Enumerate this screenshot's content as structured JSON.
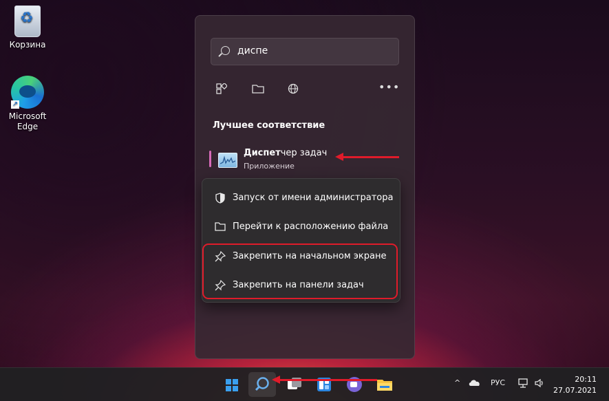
{
  "desktop": {
    "icons": [
      {
        "label": "Корзина"
      },
      {
        "label": "Microsoft Edge"
      }
    ]
  },
  "start": {
    "search_value": "диспе",
    "filters": [
      "apps-filter-icon",
      "documents-filter-icon",
      "web-filter-icon"
    ],
    "more_label": "•••",
    "section_title": "Лучшее соответствие",
    "best_match": {
      "name_highlight": "Диспет",
      "name_rest": "чер задач",
      "subtitle": "Приложение"
    }
  },
  "context_menu": {
    "items": [
      {
        "label": "Запуск от имени администратора",
        "icon": "shield-icon"
      },
      {
        "label": "Перейти к расположению файла",
        "icon": "folder-icon"
      },
      {
        "label": "Закрепить на начальном экране",
        "icon": "pin-icon"
      },
      {
        "label": "Закрепить на панели задач",
        "icon": "pin-icon"
      }
    ]
  },
  "taskbar": {
    "language": "РУС",
    "time": "20:11",
    "date": "27.07.2021"
  },
  "colors": {
    "annotation": "#e01b2a",
    "accent": "#d66ab8"
  }
}
